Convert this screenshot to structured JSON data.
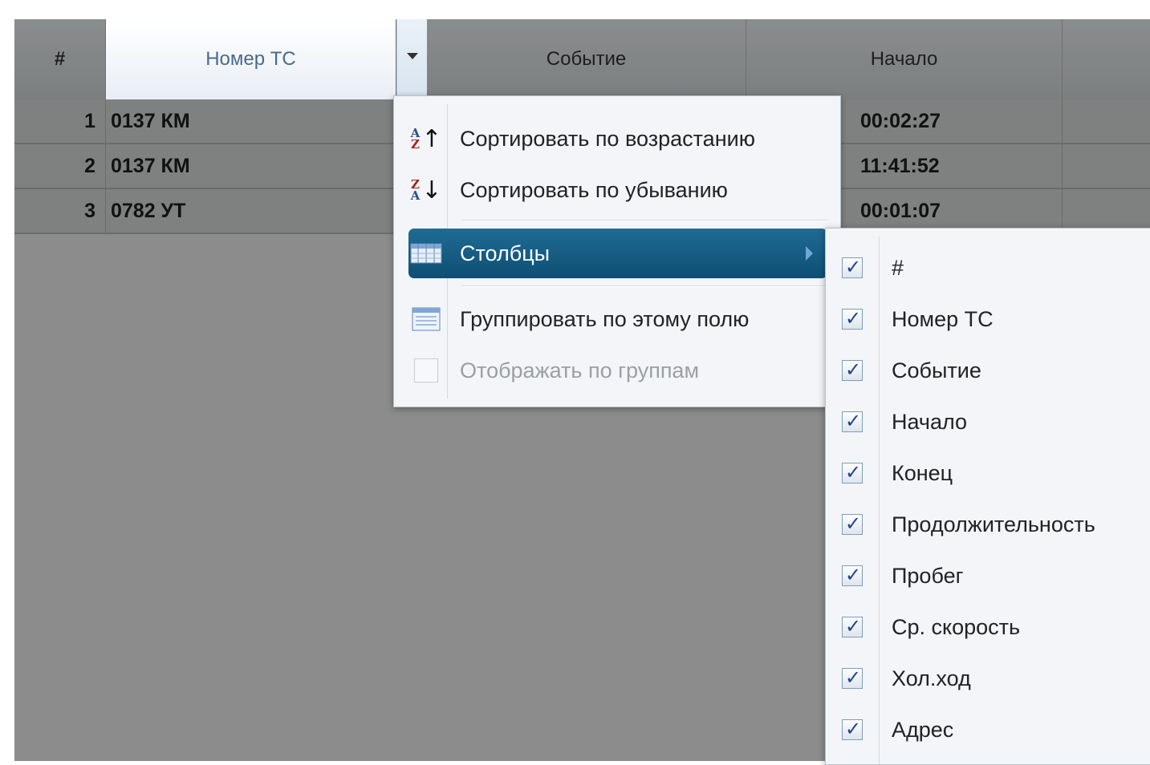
{
  "grid": {
    "columns": {
      "hash": "#",
      "plate": "Номер ТС",
      "event": "Событие",
      "start": "Начало"
    },
    "rows": [
      {
        "num": "1",
        "plate": "0137 КМ",
        "start": "00:02:27"
      },
      {
        "num": "2",
        "plate": "0137 КМ",
        "start": "11:41:52"
      },
      {
        "num": "3",
        "plate": "0782 УТ",
        "start": "00:01:07"
      }
    ]
  },
  "context_menu": {
    "sort_asc": "Сортировать по возрастанию",
    "sort_desc": "Сортировать по убыванию",
    "columns": "Столбцы",
    "group_by": "Группировать по этому полю",
    "show_groups": "Отображать по группам"
  },
  "columns_menu": {
    "items": [
      {
        "label": "#",
        "checked": true
      },
      {
        "label": "Номер ТС",
        "checked": true
      },
      {
        "label": "Событие",
        "checked": true
      },
      {
        "label": "Начало",
        "checked": true
      },
      {
        "label": "Конец",
        "checked": true
      },
      {
        "label": "Продолжительность",
        "checked": true
      },
      {
        "label": "Пробег",
        "checked": true
      },
      {
        "label": "Ср. скорость",
        "checked": true
      },
      {
        "label": "Хол.ход",
        "checked": true
      },
      {
        "label": "Адрес",
        "checked": true
      }
    ]
  },
  "colors": {
    "selected_item": "#15597f",
    "header_active": "#e8eef5",
    "grid_background": "#8c8c8c"
  }
}
